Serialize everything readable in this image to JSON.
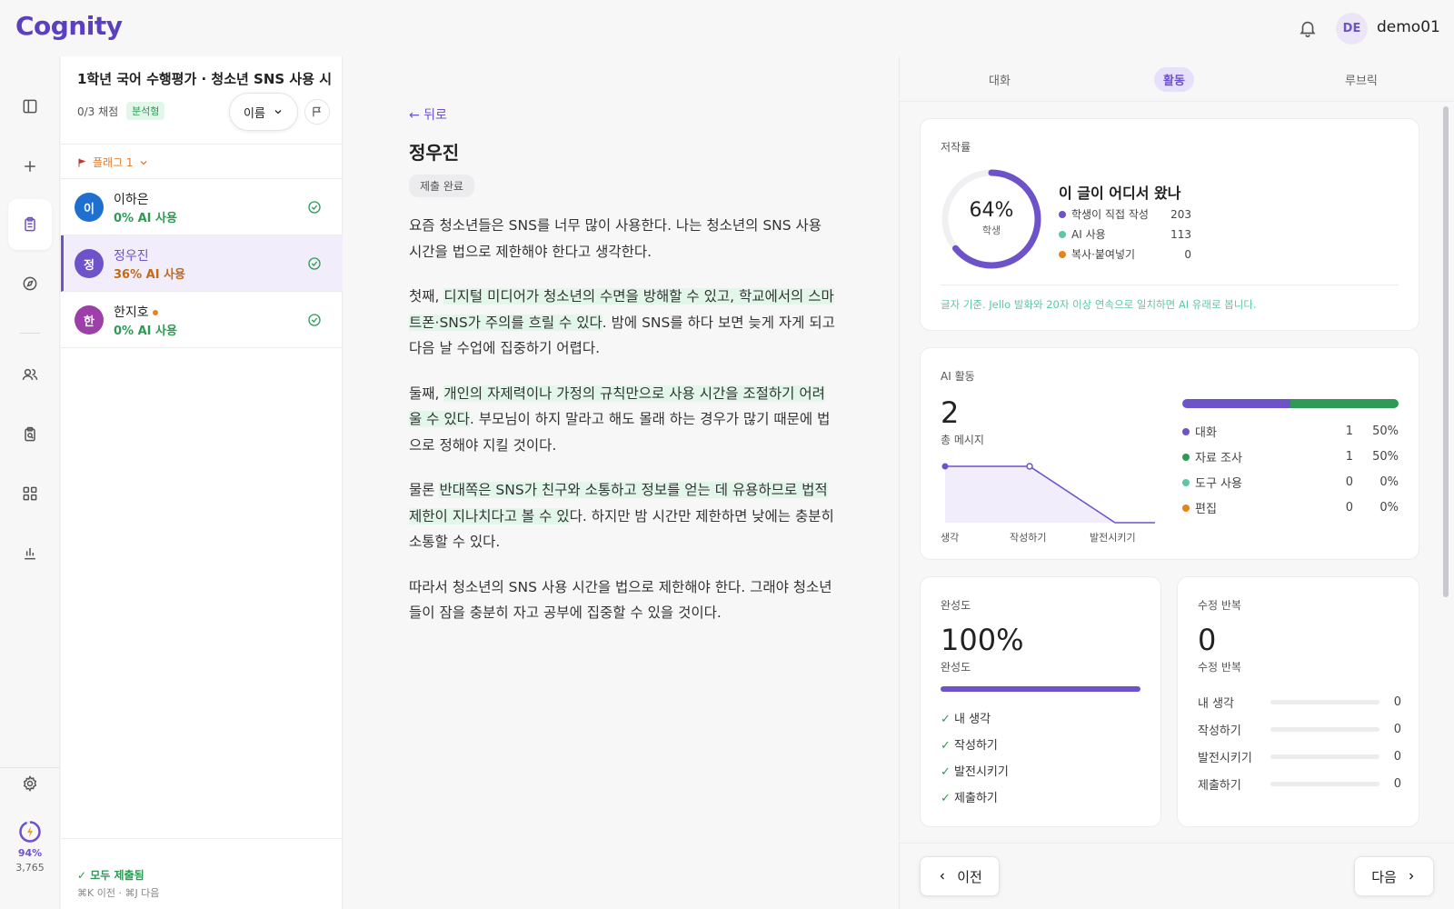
{
  "app": {
    "logo": "Cognity",
    "user_initials": "DE",
    "username": "demo01"
  },
  "rail": {
    "credit_pct": "94%",
    "credit_count": "3,765"
  },
  "assignment": {
    "title": "1학년 국어 수행평가 · 청소년 SNS 사용 시...",
    "grade_count": "0/3 채점",
    "type_badge": "분석형",
    "sort_label": "이름",
    "flag_filter": "플래그 1"
  },
  "students": [
    {
      "initial": "이",
      "name": "이하은",
      "ai": "0% AI 사용",
      "color": "#1f6fd0",
      "ai_color": "#2e9a55",
      "dot": false
    },
    {
      "initial": "정",
      "name": "정우진",
      "ai": "36% AI 사용",
      "color": "#6d52c9",
      "ai_color": "#c06a1a",
      "dot": false
    },
    {
      "initial": "한",
      "name": "한지호",
      "ai": "0% AI 사용",
      "color": "#9c3fa8",
      "ai_color": "#2e9a55",
      "dot": true
    }
  ],
  "list_footer": {
    "status": "✓ 모두 제출됨",
    "shortcut": "⌘K 이전 · ⌘J 다음"
  },
  "essay": {
    "back": "← 뒤로",
    "student": "정우진",
    "status": "제출 완료",
    "p1": "요즘 청소년들은 SNS를 너무 많이 사용한다. 나는 청소년의 SNS 사용 시간을 법으로 제한해야 한다고 생각한다.",
    "p2_a": "첫째, ",
    "p2_hl": "디지털 미디어가 청소년의 수면을 방해할 수 있고, 학교에서의 스마트폰·SNS가 주의를 흐릴 수 있다",
    "p2_b": ". 밤에 SNS를 하다 보면 늦게 자게 되고 다음 날 수업에 집중하기 어렵다.",
    "p3_a": "둘째, ",
    "p3_hl": "개인의 자제력이나 가정의 규칙만으로 사용 시간을 조절하기 어려울 수 있다",
    "p3_b": ". 부모님이 하지 말라고 해도 몰래 하는 경우가 많기 때문에 법으로 정해야 지킬 것이다.",
    "p4_a": "물론 ",
    "p4_hl": "반대쪽은 SNS가 친구와 소통하고 정보를 얻는 데 유용하므로 법적 제한이 지나치다고 볼 수 있",
    "p4_b": "다. 하지만 밤 시간만 제한하면 낮에는 충분히 소통할 수 있다.",
    "p5": "따라서 청소년의 SNS 사용 시간을 법으로 제한해야 한다. 그래야 청소년들이 잠을 충분히 자고 공부에 집중할 수 있을 것이다."
  },
  "tabs": [
    "대화",
    "활동",
    "루브릭"
  ],
  "authorship": {
    "label": "저작률",
    "pct": "64%",
    "pct_sub": "학생",
    "pct_value": 64,
    "heading": "이 글이 어디서 왔나",
    "rows": [
      {
        "label": "학생이 직접 작성",
        "value": "203",
        "color": "#6d52c9"
      },
      {
        "label": "AI 사용",
        "value": "113",
        "color": "#5cc8a0"
      },
      {
        "label": "복사·붙여넣기",
        "value": "0",
        "color": "#e8831c"
      }
    ],
    "note": "글자 기준. Jello 발화와 20자 이상 연속으로 일치하면 AI 유래로 봅니다."
  },
  "ai_activity": {
    "label": "AI 활동",
    "total": "2",
    "total_sub": "총 메시지",
    "stages": [
      "생각",
      "작성하기",
      "발전시키기"
    ],
    "rows": [
      {
        "label": "대화",
        "count": "1",
        "pct": "50%",
        "color": "#6d52c9"
      },
      {
        "label": "자료 조사",
        "count": "1",
        "pct": "50%",
        "color": "#2e9a55"
      },
      {
        "label": "도구 사용",
        "count": "0",
        "pct": "0%",
        "color": "#5cc8a0"
      },
      {
        "label": "편집",
        "count": "0",
        "pct": "0%",
        "color": "#e8831c"
      }
    ]
  },
  "completion": {
    "label": "완성도",
    "value": "100%",
    "sub": "완성도",
    "progress": 1.0,
    "steps": [
      "내 생각",
      "작성하기",
      "발전시키기",
      "제출하기"
    ]
  },
  "revisions": {
    "label": "수정 반복",
    "value": "0",
    "sub": "수정 반복",
    "rows": [
      {
        "label": "내 생각",
        "value": "0"
      },
      {
        "label": "작성하기",
        "value": "0"
      },
      {
        "label": "발전시키기",
        "value": "0"
      },
      {
        "label": "제출하기",
        "value": "0"
      }
    ]
  },
  "nav": {
    "prev": "이전",
    "next": "다음"
  }
}
